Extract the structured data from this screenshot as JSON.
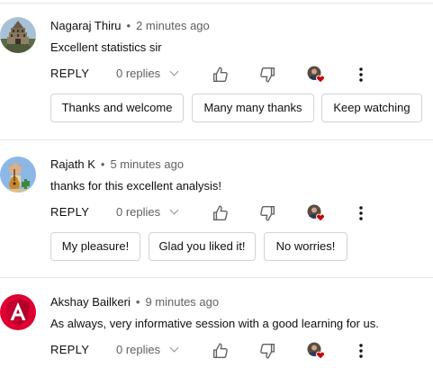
{
  "comments": [
    {
      "author": "Nagaraj Thiru",
      "time": "2 minutes ago",
      "text": "Excellent statistics sir",
      "reply_label": "REPLY",
      "replies_label": "0 replies",
      "suggestions": [
        "Thanks and welcome",
        "Many many thanks",
        "Keep watching"
      ]
    },
    {
      "author": "Rajath K",
      "time": "5 minutes ago",
      "text": "thanks for this excellent analysis!",
      "reply_label": "REPLY",
      "replies_label": "0 replies",
      "suggestions": [
        "My pleasure!",
        "Glad you liked it!",
        "No worries!"
      ]
    },
    {
      "author": "Akshay Bailkeri",
      "time": "9 minutes ago",
      "text": "As always, very informative session with a good learning for us.",
      "reply_label": "REPLY",
      "replies_label": "0 replies"
    }
  ],
  "separator": "•",
  "colors": {
    "text_primary": "#0f0f0f",
    "text_secondary": "#606060",
    "heart": "#cc0000",
    "angular_red": "#dd0031",
    "chip_border": "#d3d3d3"
  },
  "icons": {
    "like": "thumbs-up-icon",
    "dislike": "thumbs-down-icon",
    "creator_heart": "creator-heart-avatar",
    "more": "more-vert-icon",
    "chevron": "chevron-down-icon"
  }
}
